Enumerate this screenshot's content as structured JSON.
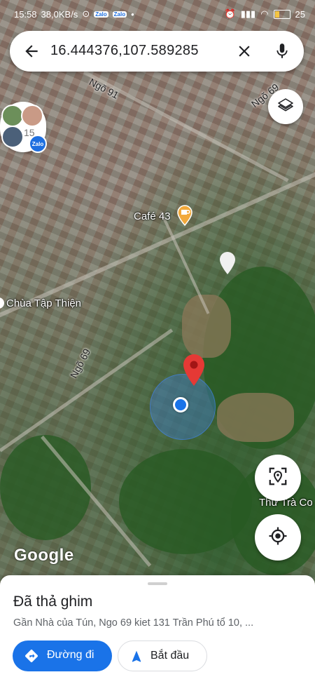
{
  "status_bar": {
    "time": "15:58",
    "speed": "38,0KB/s",
    "notif_chip": "Zalo",
    "battery": "25"
  },
  "search": {
    "query": "16.444376,107.589285"
  },
  "bubble": {
    "count": "15",
    "badge": "Zalo"
  },
  "map_labels": {
    "cafe": "Café 43",
    "pagoda": "Chùa Tập Thiện",
    "tra_co": "Thư Trà Co",
    "road_91": "Ngõ 91",
    "road_69_top": "Ngõ 69",
    "road_69_left": "Ngõ 69"
  },
  "icons": {
    "cafe": "coffee-cup-icon",
    "layers": "layers-icon",
    "locate": "my-location-icon"
  },
  "logo": "Google",
  "sheet": {
    "title": "Đã thả ghim",
    "address": "Gần Nhà của Tún, Ngo 69 kiet 131 Trần Phú tổ 10, ...",
    "directions_label": "Đường đi",
    "start_label": "Bắt đầu"
  },
  "colors": {
    "primary": "#1a73e8",
    "pin": "#e53935",
    "cafe": "#f2a93b"
  }
}
